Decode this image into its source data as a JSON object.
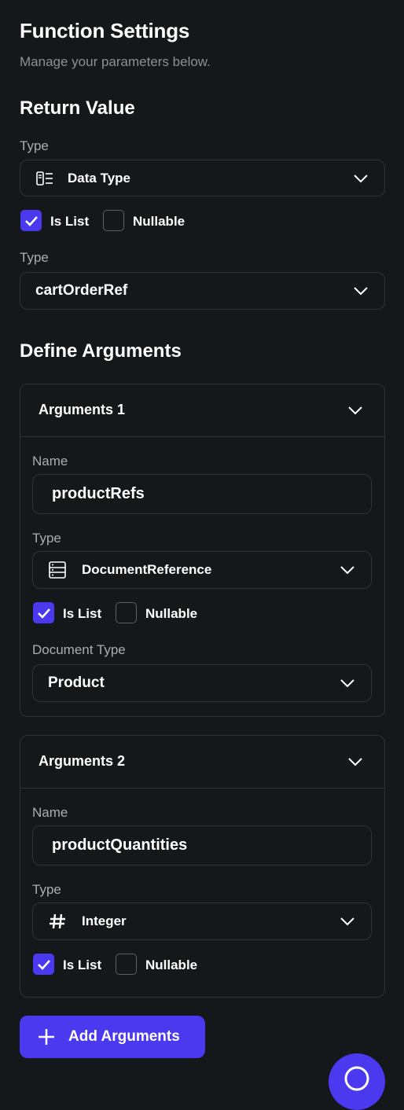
{
  "header": {
    "title": "Function Settings",
    "subtitle": "Manage your parameters below."
  },
  "return_value": {
    "heading": "Return Value",
    "type_label": "Type",
    "type_value": "Data Type",
    "type_icon": "data-type-icon",
    "is_list_label": "Is List",
    "is_list_checked": true,
    "nullable_label": "Nullable",
    "nullable_checked": false,
    "subtype_label": "Type",
    "subtype_value": "cartOrderRef"
  },
  "arguments": {
    "heading": "Define Arguments",
    "items": [
      {
        "title": "Arguments 1",
        "name_label": "Name",
        "name_value": "productRefs",
        "type_label": "Type",
        "type_value": "DocumentReference",
        "type_icon": "document-reference-icon",
        "is_list_label": "Is List",
        "is_list_checked": true,
        "nullable_label": "Nullable",
        "nullable_checked": false,
        "doc_type_label": "Document Type",
        "doc_type_value": "Product"
      },
      {
        "title": "Arguments 2",
        "name_label": "Name",
        "name_value": "productQuantities",
        "type_label": "Type",
        "type_value": "Integer",
        "type_icon": "hash-icon",
        "is_list_label": "Is List",
        "is_list_checked": true,
        "nullable_label": "Nullable",
        "nullable_checked": false
      }
    ],
    "add_button_label": "Add Arguments"
  },
  "colors": {
    "background": "#14181b",
    "accent": "#4b39ef",
    "border": "#2e3337",
    "muted_text": "#8b9096"
  }
}
